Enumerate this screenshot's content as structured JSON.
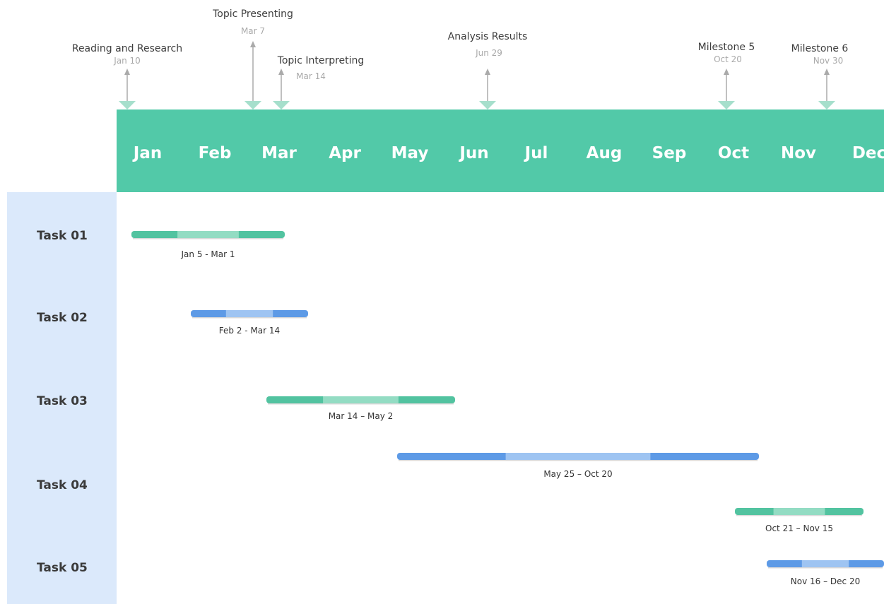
{
  "chart_data": {
    "type": "gantt",
    "months": [
      "Jan",
      "Feb",
      "Mar",
      "Apr",
      "May",
      "Jun",
      "Jul",
      "Aug",
      "Sep",
      "Oct",
      "Nov",
      "Dec"
    ],
    "milestones": [
      {
        "title": "Reading and Research",
        "date": "Jan 10",
        "month": 0,
        "day": 10
      },
      {
        "title": "Topic Presenting",
        "date": "Mar 7",
        "month": 2,
        "day": 7
      },
      {
        "title": "Topic Interpreting",
        "date": "Mar 14",
        "month": 2,
        "day": 14
      },
      {
        "title": "Analysis  Results",
        "date": "Jun 29",
        "month": 5,
        "day": 29
      },
      {
        "title": "Milestone 5",
        "date": "Oct 20",
        "month": 9,
        "day": 20
      },
      {
        "title": "Milestone 6",
        "date": "Nov 30",
        "month": 10,
        "day": 30
      }
    ],
    "tasks": [
      {
        "name": "Task 01",
        "label": "Jan 5 - Mar 1",
        "start": [
          0,
          5
        ],
        "end": [
          2,
          1
        ],
        "color": "teal"
      },
      {
        "name": "Task 02",
        "label": "Feb 2 - Mar 14",
        "start": [
          1,
          2
        ],
        "end": [
          2,
          14
        ],
        "color": "blue"
      },
      {
        "name": "Task 03",
        "label": "Mar 14 – May 2",
        "start": [
          2,
          14
        ],
        "end": [
          4,
          2
        ],
        "color": "teal"
      },
      {
        "name": "Task 04",
        "label": "May 25 – Oct 20",
        "start": [
          4,
          25
        ],
        "end": [
          9,
          20
        ],
        "color": "blue"
      },
      {
        "name": "",
        "label": "Oct 21 – Nov 15",
        "start": [
          9,
          21
        ],
        "end": [
          10,
          15
        ],
        "color": "teal"
      },
      {
        "name": "Task 05",
        "label": "Nov 16 – Dec 20",
        "start": [
          10,
          16
        ],
        "end": [
          11,
          20
        ],
        "color": "blue"
      }
    ]
  },
  "colors": {
    "header_bg": "#52c9a8",
    "sidebar_bg": "#dbe9fb",
    "teal_dark": "#52c3a0",
    "teal_light": "#93dcc3",
    "blue_dark": "#5d9ae6",
    "blue_light": "#9ec4f2",
    "marker": "#a6dfcc",
    "arrow": "#aaaaaa"
  }
}
